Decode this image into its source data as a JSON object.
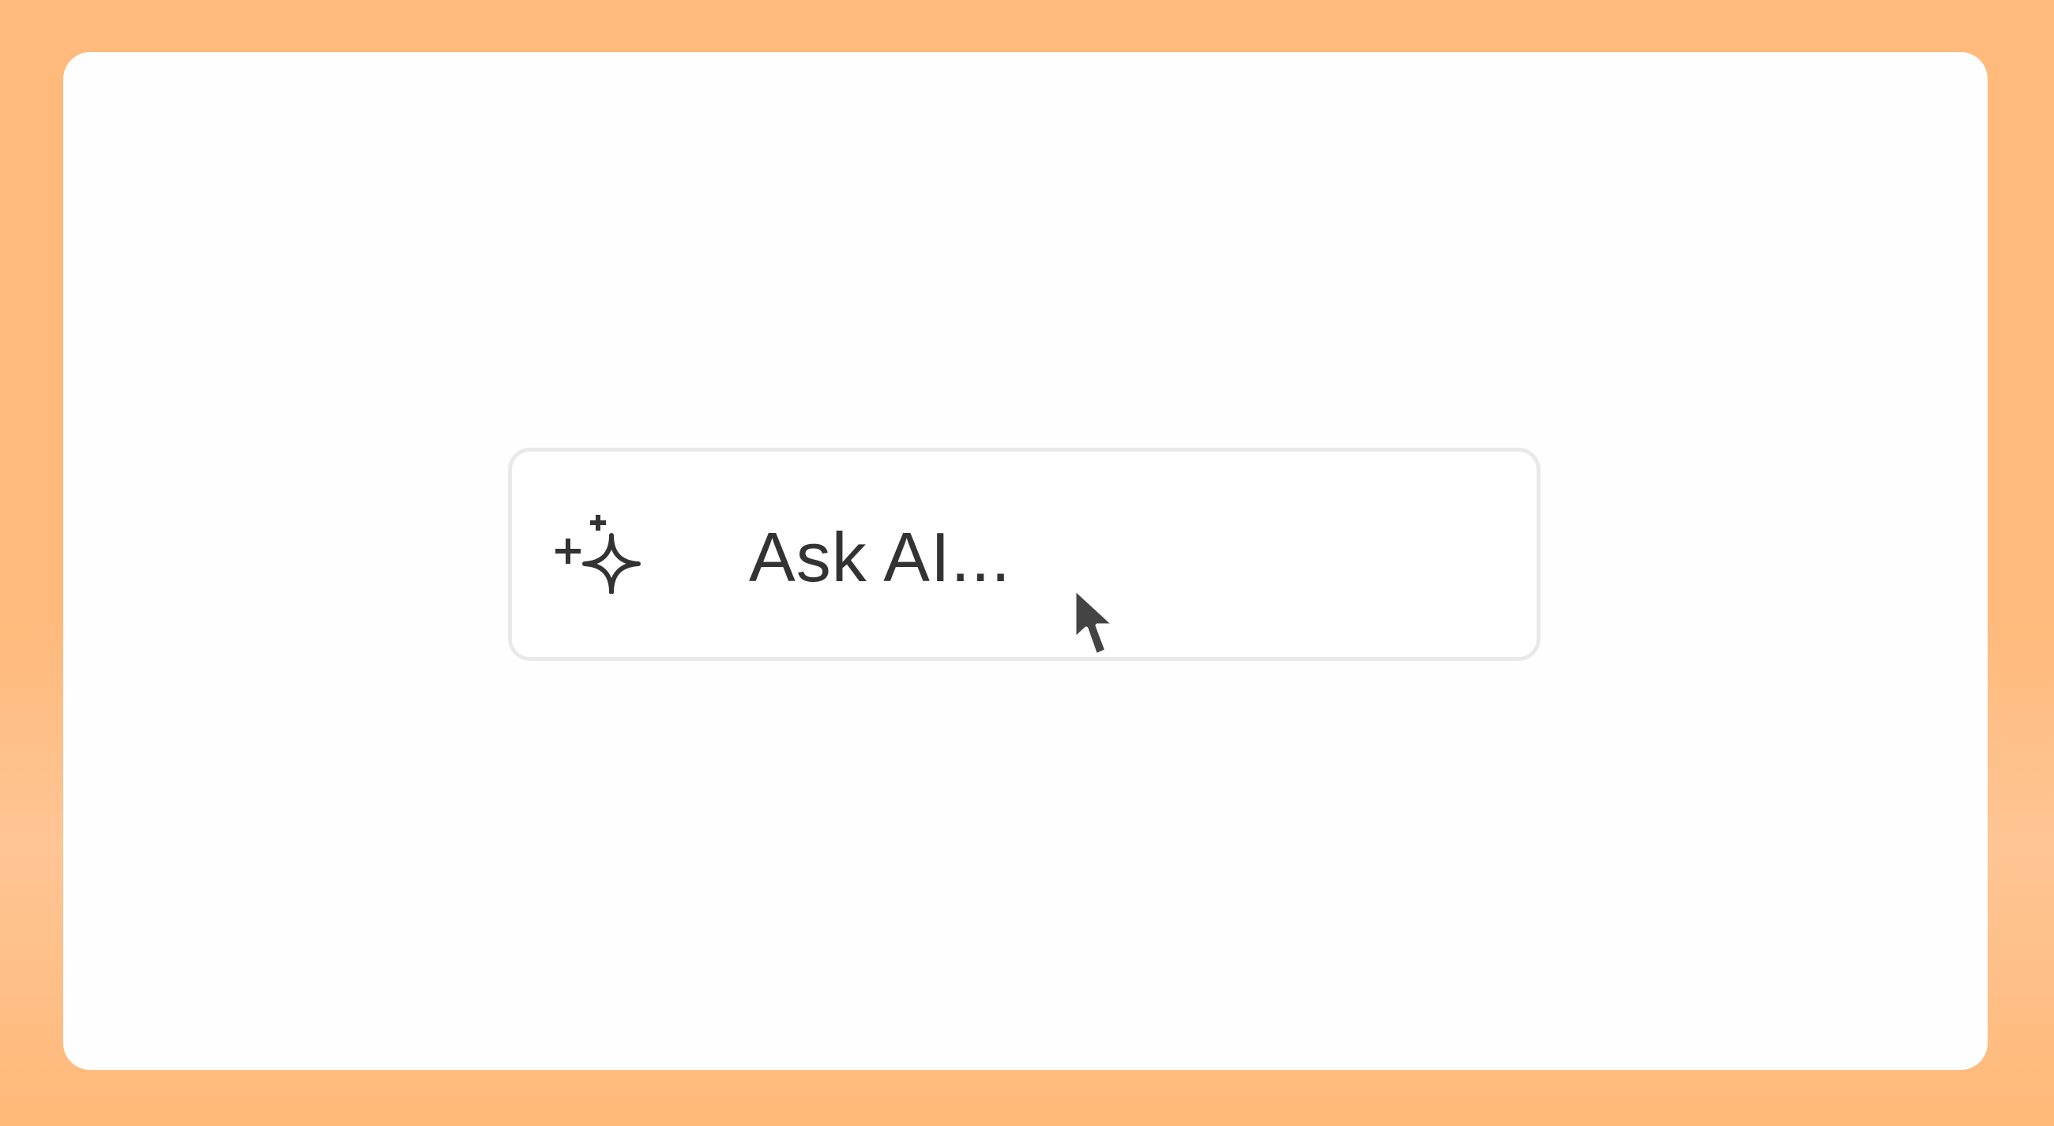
{
  "ask_ai": {
    "placeholder": "Ask AI...",
    "icon": "sparkles-icon"
  },
  "pointer": {
    "icon": "mouse-pointer-icon"
  },
  "colors": {
    "background": "#ffba7c",
    "card": "#fefefe",
    "box_border": "#e9e9e9",
    "text": "#333333"
  }
}
